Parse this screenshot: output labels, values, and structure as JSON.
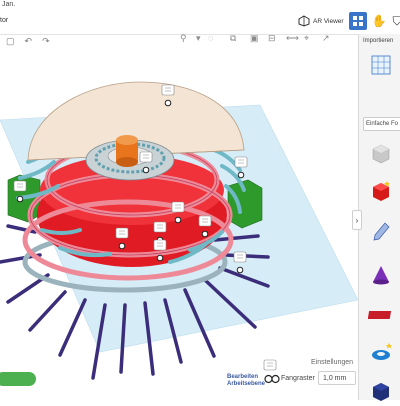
{
  "app": {
    "title_fragment": "Jan.",
    "doc_fragment": "tor"
  },
  "header": {
    "ar_viewer_label": "AR Viewer",
    "buttons": [
      "grid-view",
      "hands-icon",
      "user-icon",
      "code-icon"
    ]
  },
  "panel": {
    "import_label": "Importieren",
    "category_label": "Einfache Fo",
    "shapes": [
      "workplane-grid",
      "box-hole",
      "box-red",
      "text-pen",
      "cone-purple",
      "text-red",
      "torus-blue",
      "cube-navy"
    ]
  },
  "canvas": {
    "settings_label": "Einstellungen",
    "snap_label": "Fangraster",
    "snap_value": "1,0 mm",
    "workplane_label_1": "Bearbeiten",
    "workplane_label_2": "Arbeitsebene"
  },
  "colors": {
    "accent": "#3a74c9",
    "red": "#e01b24",
    "pink": "#ee8a98",
    "teal": "#6fb9c7",
    "purple": "#3b2d7a",
    "green": "#32a02f",
    "orange": "#e8741c"
  }
}
